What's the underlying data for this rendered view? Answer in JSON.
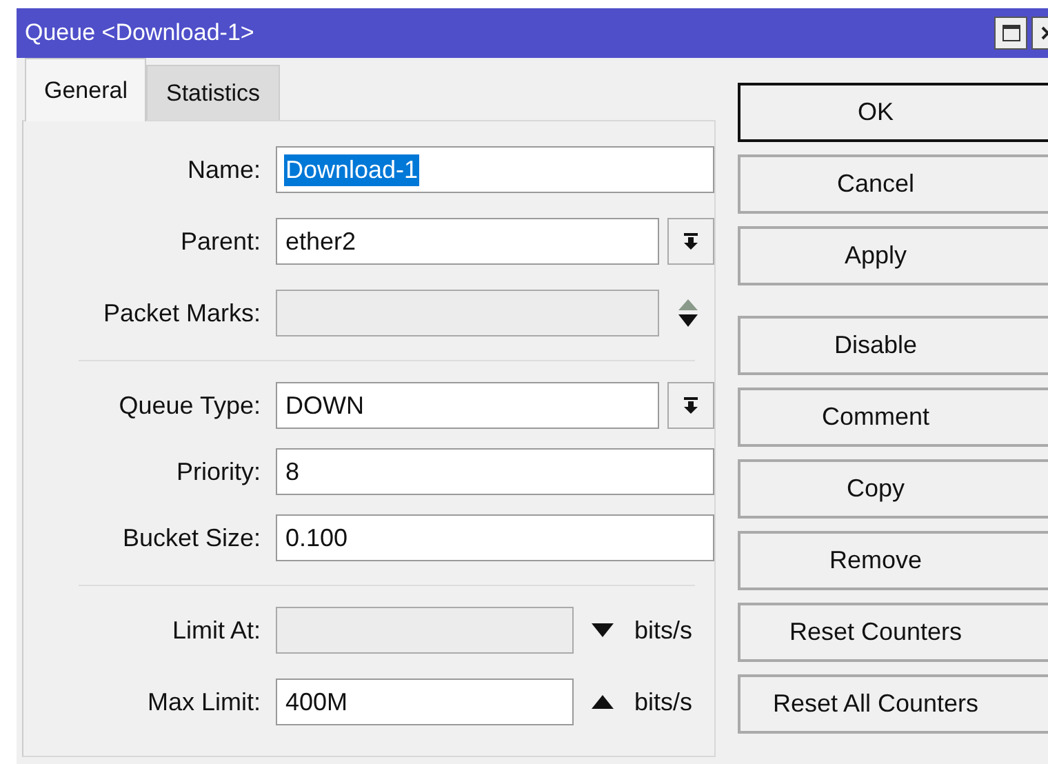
{
  "window": {
    "title": "Queue <Download-1>"
  },
  "tabs": [
    {
      "label": "General",
      "selected": true
    },
    {
      "label": "Statistics",
      "selected": false
    }
  ],
  "field_groups": [
    [
      {
        "kind": "text",
        "label": "Name:",
        "value": "Download-1",
        "value_selected": true,
        "disabled": false
      },
      {
        "kind": "dropdown",
        "label": "Parent:",
        "value": "ether2",
        "disabled": false
      },
      {
        "kind": "multi",
        "label": "Packet Marks:",
        "disabled": true
      }
    ],
    [
      {
        "kind": "dropdown",
        "label": "Queue Type:",
        "value": "DOWN",
        "disabled": false
      },
      {
        "kind": "text",
        "label": "Priority:",
        "value": "8",
        "disabled": false
      },
      {
        "kind": "text",
        "label": "Bucket Size:",
        "value": "0.100",
        "disabled": false
      }
    ],
    [
      {
        "kind": "rate",
        "label": "Limit At:",
        "arrow_up": false,
        "unit": "bits/s",
        "disabled": true
      },
      {
        "kind": "rate",
        "label": "Max Limit:",
        "value": "400M",
        "arrow_up": true,
        "unit": "bits/s",
        "disabled": false
      }
    ]
  ],
  "button_groups": [
    [
      {
        "label": "OK",
        "default": true
      },
      {
        "label": "Cancel",
        "default": false
      },
      {
        "label": "Apply",
        "default": false
      }
    ],
    [
      {
        "label": "Disable",
        "default": false
      },
      {
        "label": "Comment",
        "default": false
      },
      {
        "label": "Copy",
        "default": false
      },
      {
        "label": "Remove",
        "default": false
      },
      {
        "label": "Reset Counters",
        "default": false
      },
      {
        "label": "Reset All Counters",
        "default": false
      }
    ]
  ]
}
